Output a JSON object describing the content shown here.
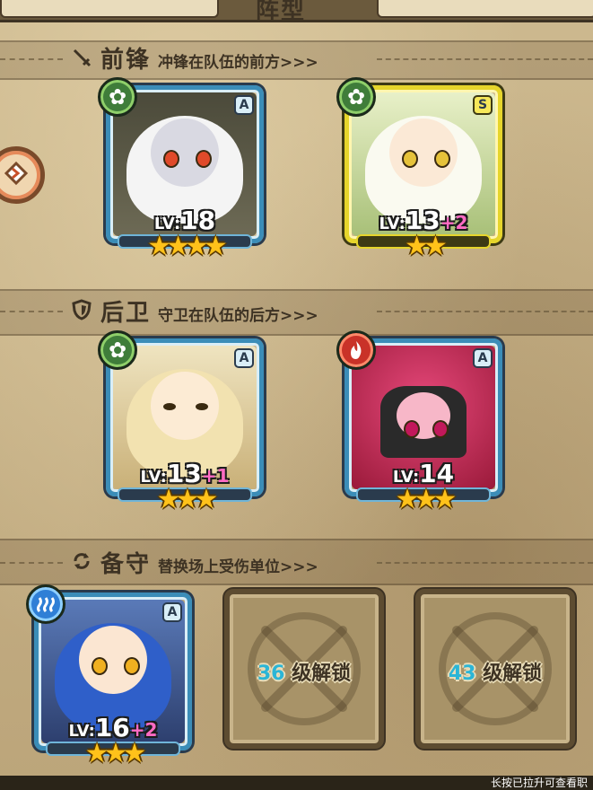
{
  "header": {
    "title": "阵型"
  },
  "sections": {
    "front": {
      "icon": "sword-icon",
      "title": "前锋",
      "desc": "冲锋在队伍的前方>>>"
    },
    "back": {
      "icon": "shield-icon",
      "title": "后卫",
      "desc": "守卫在队伍的后方>>>"
    },
    "reserve": {
      "icon": "swap-icon",
      "title": "备守",
      "desc": "替换场上受伤单位>>>"
    }
  },
  "units": [
    {
      "slot": "front-1",
      "element": "leaf",
      "rank": "A",
      "lv_prefix": "LV:",
      "level": "18",
      "bonus": "",
      "stars": 4,
      "frame": "blue"
    },
    {
      "slot": "front-2",
      "element": "leaf",
      "rank": "S",
      "lv_prefix": "LV:",
      "level": "13",
      "bonus": "+2",
      "stars": 2,
      "frame": "gold"
    },
    {
      "slot": "back-1",
      "element": "leaf",
      "rank": "A",
      "lv_prefix": "LV:",
      "level": "13",
      "bonus": "+1",
      "stars": 3,
      "frame": "blue"
    },
    {
      "slot": "back-2",
      "element": "fire",
      "rank": "A",
      "lv_prefix": "LV:",
      "level": "14",
      "bonus": "",
      "stars": 3,
      "frame": "blue"
    },
    {
      "slot": "reserve-1",
      "element": "water",
      "rank": "A",
      "lv_prefix": "LV:",
      "level": "16",
      "bonus": "+2",
      "stars": 3,
      "frame": "blue"
    }
  ],
  "locked_slots": [
    {
      "unlock_level": "36",
      "unlock_text": "级解锁"
    },
    {
      "unlock_level": "43",
      "unlock_text": "级解锁"
    }
  ],
  "footer": {
    "hint": "长按已拉升可查看职"
  },
  "colors": {
    "leaf": "#3f7d3a",
    "fire": "#c93228",
    "water": "#2f7fd6",
    "frame_blue": "#3b8db8",
    "frame_gold": "#e6d52b",
    "bonus": "#ff6bc4",
    "unlock": "#2bb5d6"
  }
}
